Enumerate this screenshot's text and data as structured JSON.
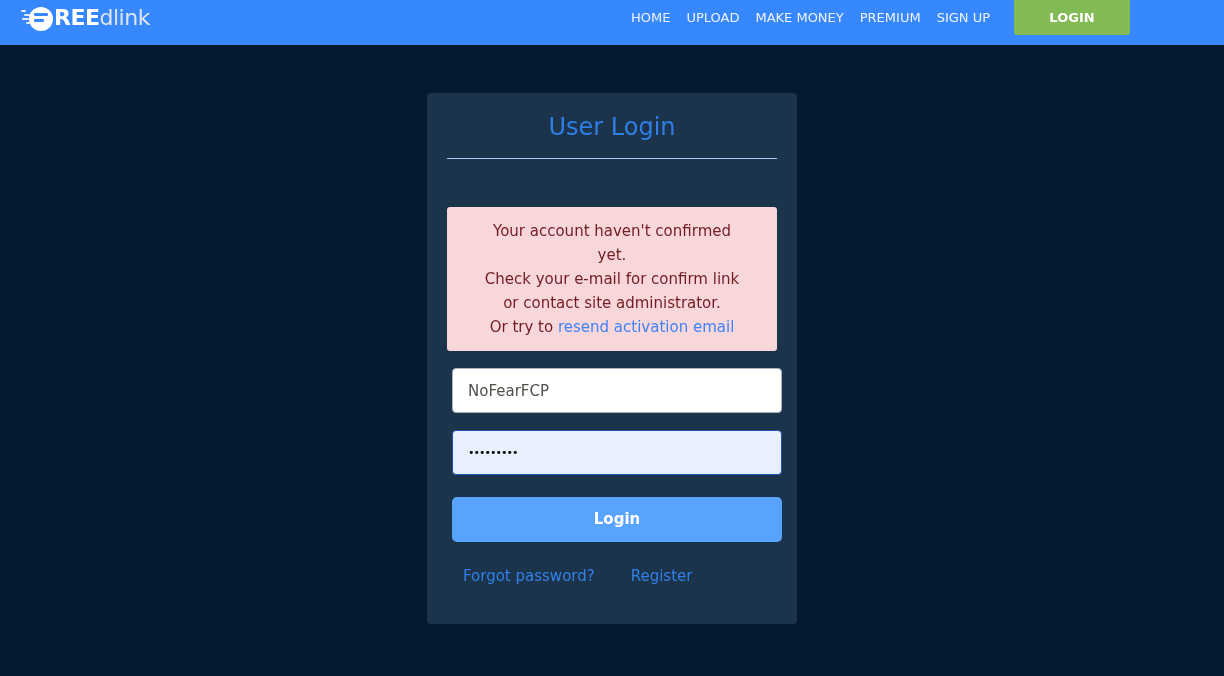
{
  "header": {
    "logo": {
      "strong": "REE",
      "light": "dlink"
    },
    "nav": [
      {
        "label": "HOME"
      },
      {
        "label": "UPLOAD"
      },
      {
        "label": "MAKE MONEY"
      },
      {
        "label": "PREMIUM"
      },
      {
        "label": "SIGN UP"
      }
    ],
    "login_button": "LOGIN"
  },
  "login_card": {
    "title": "User Login",
    "alert": {
      "lines": [
        "Your account haven't confirmed yet.",
        "Check your e-mail for confirm link or contact site administrator."
      ],
      "prefix": "Or try to",
      "link": "resend activation email"
    },
    "fields": [
      {
        "kind": "text",
        "value": "NoFearFCP",
        "focused": false
      },
      {
        "kind": "password",
        "value": "•••••••••",
        "focused": true
      }
    ],
    "submit": "Login",
    "links": [
      "Forgot password?",
      "Register"
    ]
  }
}
